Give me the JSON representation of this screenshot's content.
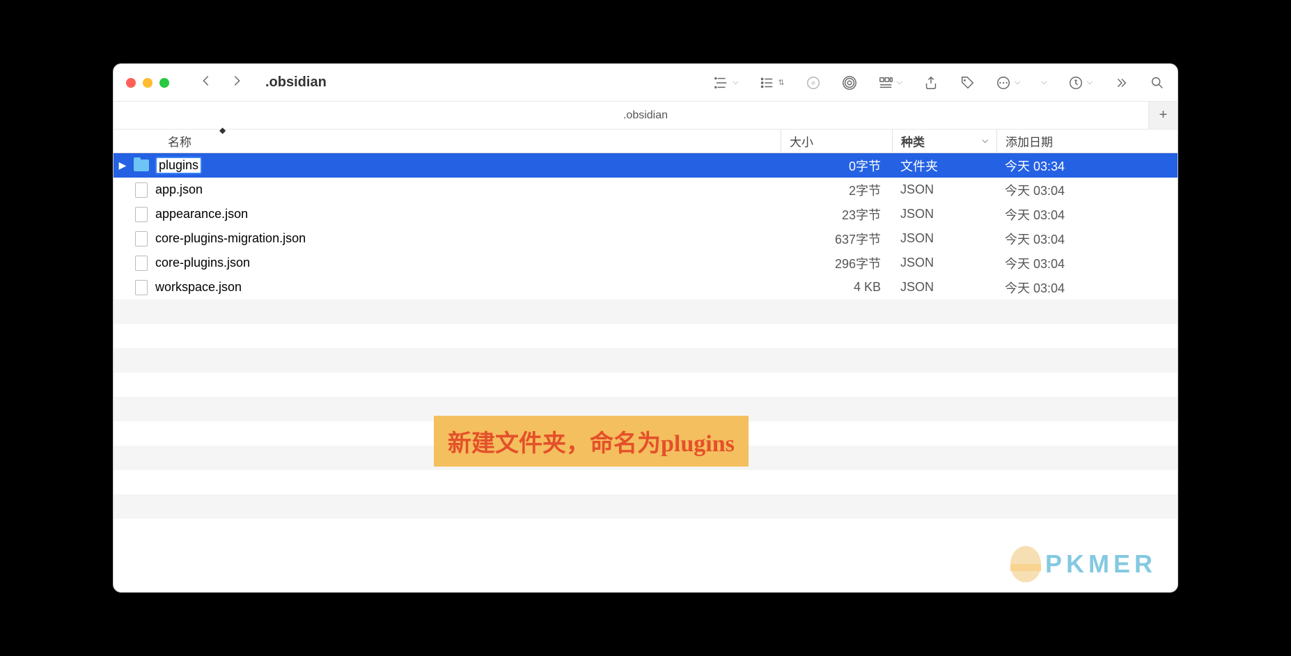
{
  "window": {
    "folder_title": ".obsidian",
    "path_bar": ".obsidian"
  },
  "columns": {
    "name": "名称",
    "size": "大小",
    "kind": "种类",
    "date": "添加日期"
  },
  "files": [
    {
      "name": "plugins",
      "size": "0字节",
      "kind": "文件夹",
      "date": "今天 03:34",
      "is_folder": true,
      "selected": true,
      "editing": true
    },
    {
      "name": "app.json",
      "size": "2字节",
      "kind": "JSON",
      "date": "今天 03:04",
      "is_folder": false
    },
    {
      "name": "appearance.json",
      "size": "23字节",
      "kind": "JSON",
      "date": "今天 03:04",
      "is_folder": false
    },
    {
      "name": "core-plugins-migration.json",
      "size": "637字节",
      "kind": "JSON",
      "date": "今天 03:04",
      "is_folder": false
    },
    {
      "name": "core-plugins.json",
      "size": "296字节",
      "kind": "JSON",
      "date": "今天 03:04",
      "is_folder": false
    },
    {
      "name": "workspace.json",
      "size": "4 KB",
      "kind": "JSON",
      "date": "今天 03:04",
      "is_folder": false
    }
  ],
  "annotation": "新建文件夹，命名为plugins",
  "watermark": "PKMER"
}
